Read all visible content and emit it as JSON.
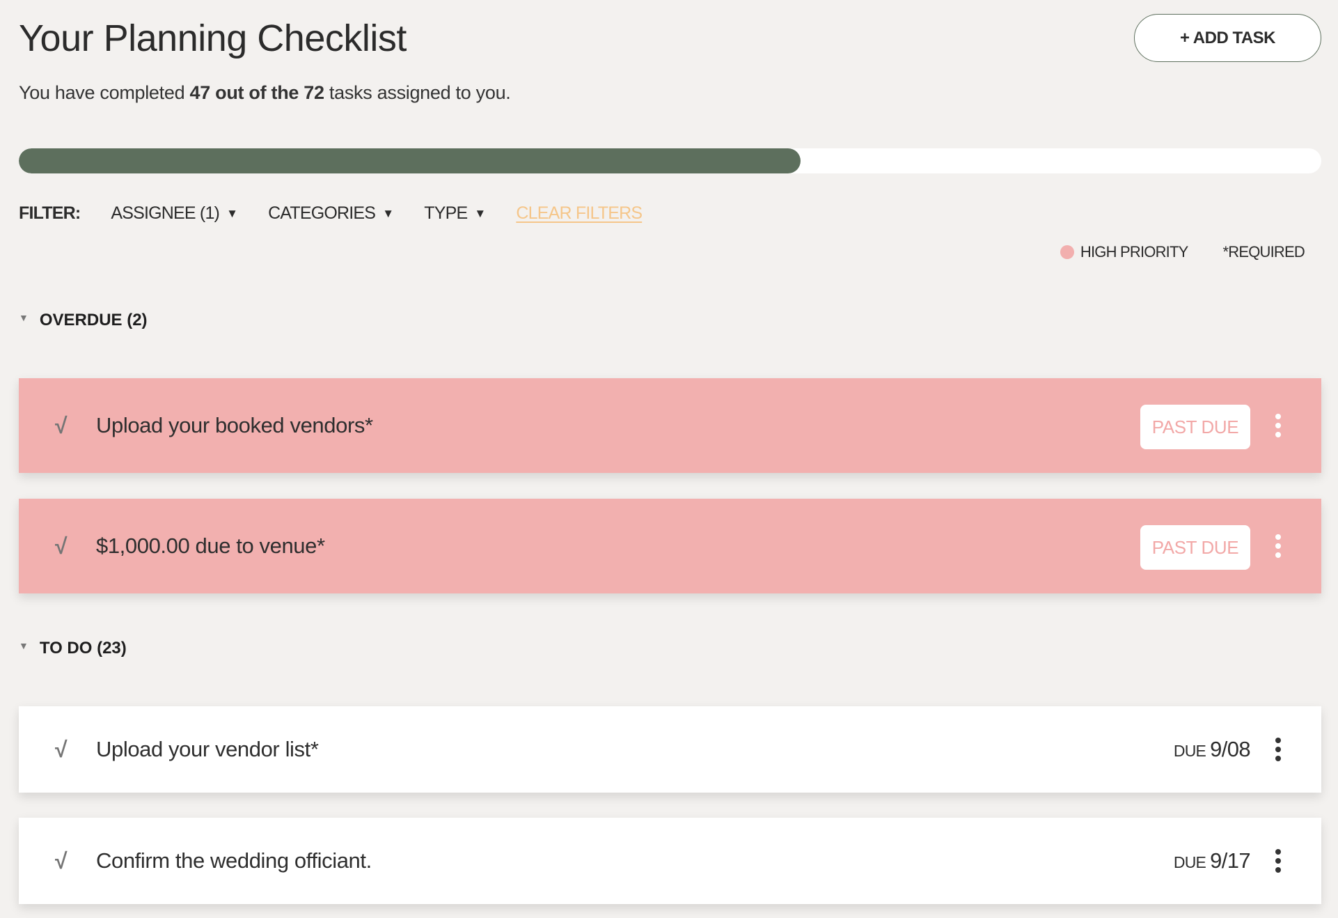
{
  "header": {
    "title": "Your Planning Checklist",
    "add_task_label": "+ ADD TASK"
  },
  "summary": {
    "prefix": "You have completed ",
    "bold": "47 out of the 72",
    "suffix": " tasks assigned to you.",
    "completed": 47,
    "total": 72
  },
  "progress": {
    "fraction_shown": 0.6,
    "fill_color": "#5d6f5d",
    "track_color": "#ffffff"
  },
  "filters": {
    "label": "FILTER:",
    "dropdowns": [
      {
        "label": "ASSIGNEE (1)",
        "caret": "▼"
      },
      {
        "label": "CATEGORIES",
        "caret": "▼"
      },
      {
        "label": "TYPE",
        "caret": "▼"
      }
    ],
    "clear_label": "CLEAR FILTERS"
  },
  "legend": {
    "high_priority_label": "HIGH PRIORITY",
    "high_priority_color": "#f2afae",
    "required_label": "*REQUIRED"
  },
  "sections": [
    {
      "title": "OVERDUE (2)",
      "toggle": "▼",
      "tasks": [
        {
          "check": "√",
          "name": "Upload your booked vendors*",
          "status": "PAST DUE"
        },
        {
          "check": "√",
          "name": "$1,000.00 due to venue*",
          "status": "PAST DUE"
        }
      ]
    },
    {
      "title": "TO DO (23)",
      "toggle": "▼",
      "tasks": [
        {
          "check": "√",
          "name": "Upload your vendor list*",
          "due_label": "DUE",
          "due_date": "9/08"
        },
        {
          "check": "√",
          "name": "Confirm the wedding officiant.",
          "due_label": "DUE",
          "due_date": "9/17"
        }
      ]
    }
  ],
  "colors": {
    "background": "#f3f1ef",
    "overdue_row": "#f2b0af",
    "accent_green": "#5d6f5d",
    "clear_filters": "#f5c68a"
  }
}
